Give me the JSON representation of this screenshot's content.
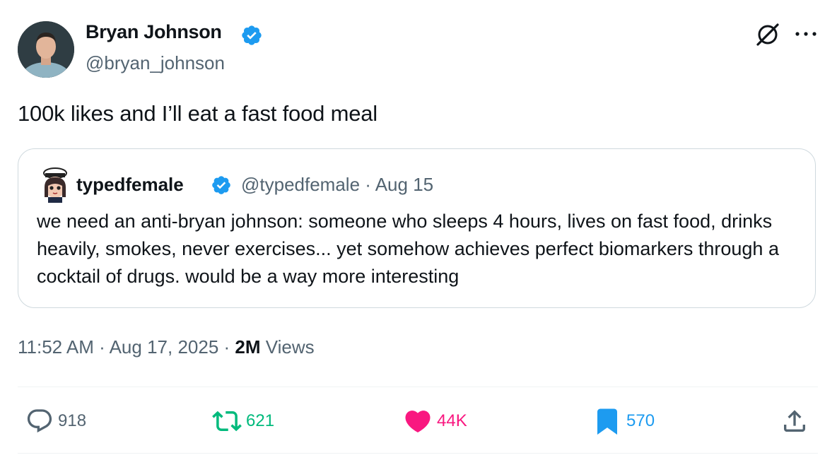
{
  "author": {
    "name": "Bryan Johnson",
    "handle": "@bryan_johnson"
  },
  "tweet": {
    "text": "100k likes and I’ll eat a fast food meal",
    "timestamp": "11:52 AM · Aug 17, 2025 · ",
    "views_count": "2M",
    "views_label": " Views"
  },
  "quote": {
    "name": "typedfemale",
    "handle_date": "@typedfemale · Aug 15",
    "text": "we need an anti-bryan johnson: someone who sleeps 4 hours, lives on fast food, drinks heavily, smokes, never exercises... yet somehow achieves perfect biomarkers through a cocktail of drugs. would be a way more interesting"
  },
  "actions": {
    "replies": "918",
    "retweets": "621",
    "likes": "44K",
    "bookmarks": "570"
  },
  "colors": {
    "verified": "#1d9bf0",
    "retweet": "#00ba7c",
    "like": "#f91880",
    "bookmark": "#1d9bf0",
    "muted": "#536471"
  },
  "icons": [
    "verified-badge-icon",
    "grok-icon",
    "more-icon",
    "reply-icon",
    "retweet-icon",
    "like-icon",
    "bookmark-icon",
    "share-icon"
  ]
}
